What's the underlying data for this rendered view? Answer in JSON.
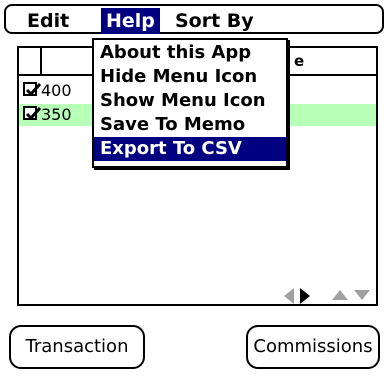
{
  "menubar": {
    "items": [
      "Edit",
      "Help",
      "Sort By"
    ],
    "selected": "Help"
  },
  "list": {
    "header_fragment": "e",
    "rows": [
      {
        "value": "400",
        "checked": true
      },
      {
        "value": "350",
        "checked": true
      }
    ]
  },
  "help_menu": {
    "items": [
      "About this App",
      "Hide Menu Icon",
      "Show Menu Icon",
      "Save To Memo",
      "Export To CSV"
    ],
    "highlighted": "Export To CSV"
  },
  "buttons": {
    "transaction": "Transaction",
    "commissions": "Commissions"
  },
  "colors": {
    "menu_highlight": "#000080",
    "row_highlight": "#b8ffb8"
  },
  "icons": [
    "checkmark-icon",
    "scroll-left-arrow-icon",
    "scroll-right-arrow-icon",
    "scroll-up-arrow-icon",
    "scroll-down-arrow-icon"
  ]
}
